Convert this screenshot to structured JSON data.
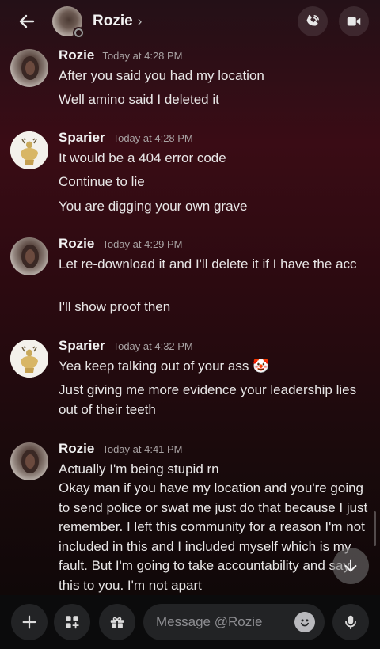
{
  "header": {
    "name": "Rozie",
    "chevron": "›"
  },
  "icons": {
    "back": "arrow-left-icon",
    "call": "phone-call-icon",
    "video": "video-camera-icon",
    "plus": "plus-icon",
    "apps": "apps-icon",
    "gift": "gift-icon",
    "emoji": "emoji-icon",
    "mic": "microphone-icon",
    "scroll": "arrow-down-icon"
  },
  "messages": [
    {
      "author": "Rozie",
      "time": "Today at 4:28 PM",
      "lines": [
        "After you said you had my location",
        "Well amino said I deleted it"
      ]
    },
    {
      "author": "Sparier",
      "time": "Today at 4:28 PM",
      "lines": [
        "It would be a 404 error code",
        "Continue to lie",
        "You are digging your own grave"
      ]
    },
    {
      "author": "Rozie",
      "time": "Today at 4:29 PM",
      "lines": [
        "Let re-download it and I'll delete it if I have the acc",
        "I'll show proof then"
      ]
    },
    {
      "author": "Sparier",
      "time": "Today at 4:32 PM",
      "lines": [
        "Yea keep talking out of your ass 🤡",
        "Just giving me more evidence your leadership lies out of their teeth"
      ]
    },
    {
      "author": "Rozie",
      "time": "Today at 4:41 PM",
      "lines": [
        "Actually I'm being stupid rn",
        "Okay man if you have my location and you're going to send police or swat me just do that because I just remember. I left this community for a reason I'm not included in this and I included myself which is my fault. But I'm going to take accountability and say this to you. I'm not apart"
      ]
    }
  ],
  "composer": {
    "placeholder": "Message @Rozie"
  },
  "colors": {
    "accent_bg_top": "#3a0c15",
    "composer_bg": "#0b0b0c",
    "button_bg": "#222325"
  }
}
